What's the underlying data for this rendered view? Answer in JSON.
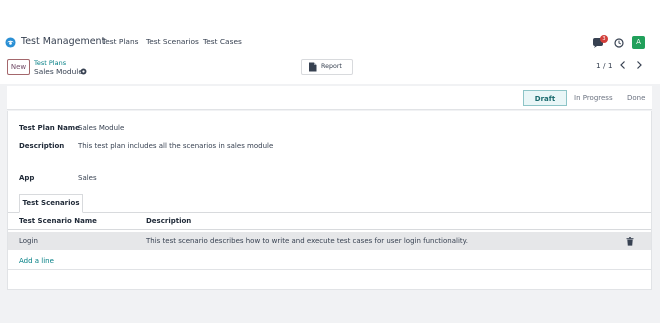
{
  "navbar": {
    "app_name": "Test Management",
    "menu": [
      "Test Plans",
      "Test Scenarios",
      "Test Cases"
    ],
    "chat_badge": "3",
    "avatar_letter": "A"
  },
  "control": {
    "new_label": "New",
    "breadcrumb_parent": "Test Plans",
    "breadcrumb_current": "Sales Module",
    "report_label": "Report",
    "pager": "1 / 1"
  },
  "status": {
    "stages": [
      "Draft",
      "In Progress",
      "Done"
    ],
    "active": "Draft"
  },
  "form": {
    "name_label": "Test Plan Name",
    "name_value": "Sales Module",
    "description_label": "Description",
    "description_value": "This test plan includes all the scenarios in sales module",
    "app_label": "App",
    "app_value": "Sales"
  },
  "tabs": {
    "active_label": "Test Scenarios"
  },
  "table": {
    "columns": [
      "Test Scenario Name",
      "Description"
    ],
    "rows": [
      {
        "name": "Login",
        "description": "This test scenario describes how to write and execute test cases for user login functionality."
      }
    ],
    "add_line": "Add a line"
  },
  "colors": {
    "brand": "#714b67",
    "link": "#017e84",
    "badge": "#d23f3a",
    "avatar": "#21a05b"
  }
}
